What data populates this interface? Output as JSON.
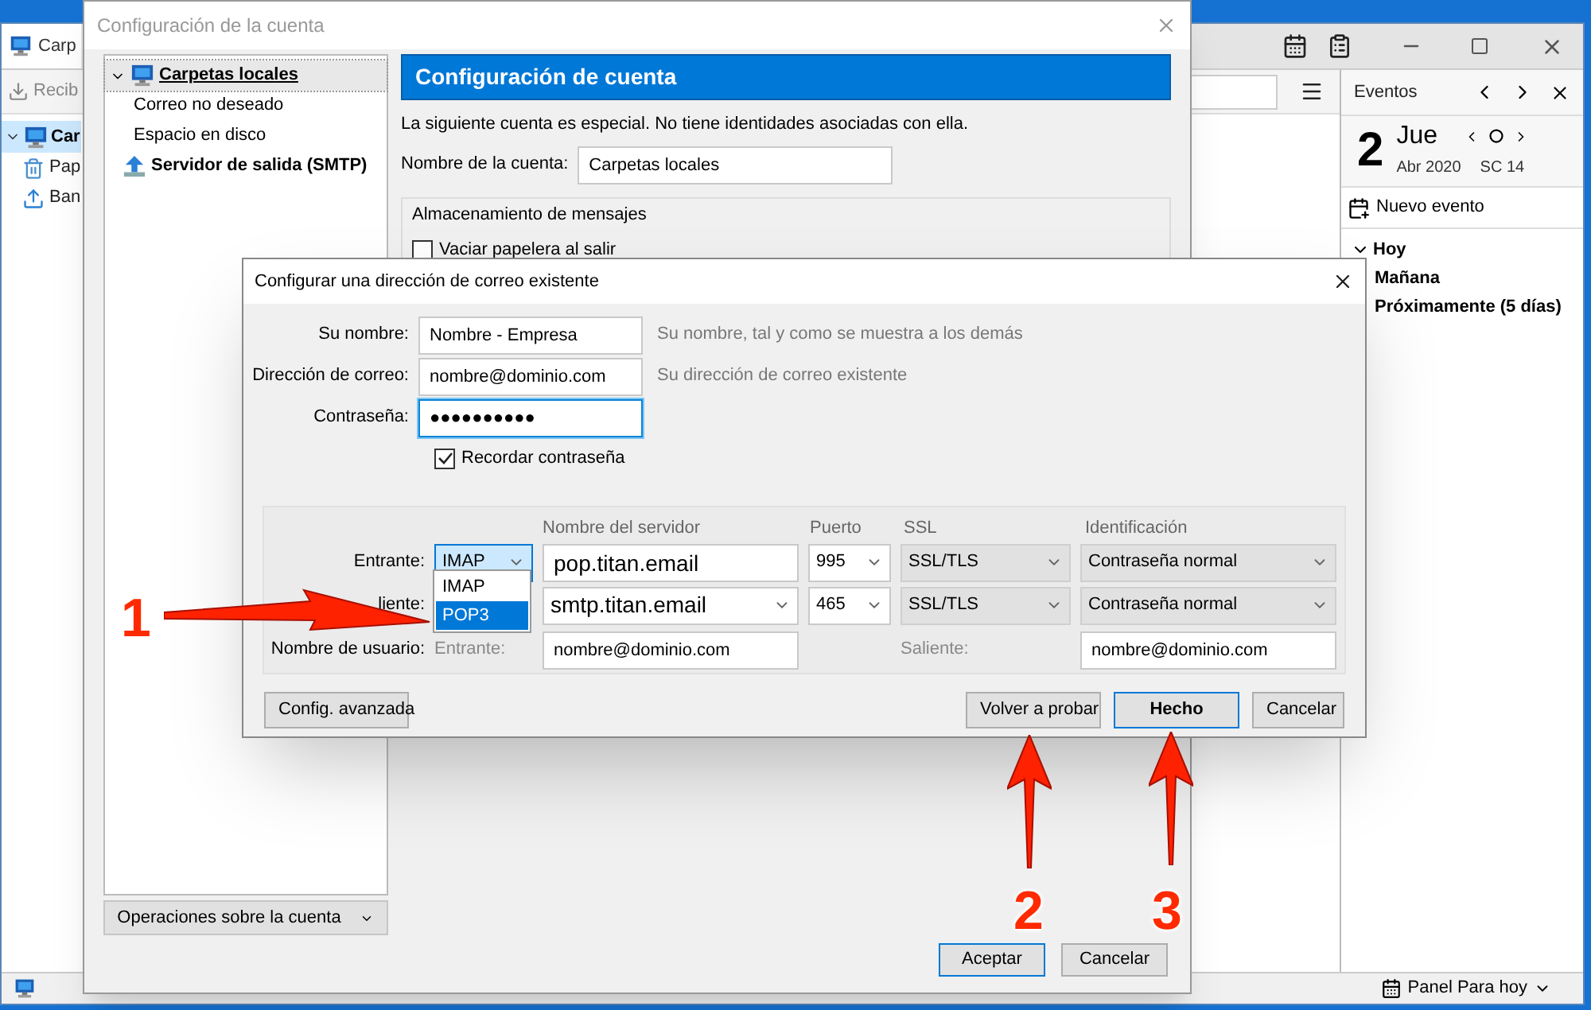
{
  "main_window": {
    "tab": {
      "label": "Carp"
    },
    "toolbar": {
      "get_mail": "Recib"
    },
    "folders": [
      {
        "label": "Car",
        "kind": "account",
        "expanded": true,
        "selected": true,
        "children": [
          {
            "label": "Pap",
            "kind": "trash",
            "selected": false
          },
          {
            "label": "Ban",
            "kind": "outbox",
            "selected": false
          }
        ]
      }
    ],
    "events_pane": {
      "title": "Eventos",
      "day": "2",
      "weekday": "Jue",
      "month_year": "Abr 2020",
      "week": "SC 14",
      "new_event": "Nuevo evento",
      "sections": [
        {
          "label": "Hoy",
          "expanded": true
        },
        {
          "label": "Mañana",
          "expanded": false
        },
        {
          "label": "Próximamente (5 días)",
          "expanded": false
        }
      ]
    },
    "status_bar": {
      "today_pane": "Panel Para hoy"
    }
  },
  "account_settings": {
    "title": "Configuración de la cuenta",
    "tree": [
      {
        "label": "Carpetas locales",
        "kind": "account",
        "expanded": true,
        "selected": true,
        "children": [
          {
            "label": "Correo no deseado",
            "selected": false
          },
          {
            "label": "Espacio en disco",
            "selected": false
          }
        ]
      },
      {
        "label": "Servidor de salida (SMTP)",
        "kind": "smtp",
        "selected": false
      }
    ],
    "account_actions": "Operaciones sobre la cuenta",
    "header": "Configuración de cuenta",
    "description": "La siguiente cuenta es especial. No tiene identidades asociadas con ella.",
    "account_name": {
      "label": "Nombre de la cuenta:",
      "value": "Carpetas locales"
    },
    "storage": {
      "title": "Almacenamiento de mensajes",
      "empty_trash": {
        "label": "Vaciar papelera al salir",
        "checked": false
      }
    },
    "buttons": [
      {
        "label": "Aceptar",
        "default": true
      },
      {
        "label": "Cancelar",
        "default": false
      }
    ]
  },
  "dialog": {
    "title": "Configurar una dirección de correo existente",
    "fields": [
      {
        "label": "Su nombre:",
        "value": "Nombre - Empresa",
        "hint": "Su nombre, tal y como se muestra a los demás",
        "focused": false
      },
      {
        "label": "Dirección de correo:",
        "value": "nombre@dominio.com",
        "hint": "Su dirección de correo existente",
        "focused": false
      },
      {
        "label": "Contraseña:",
        "value": "●●●●●●●●●●",
        "focused": true
      }
    ],
    "remember_password": {
      "label": "Recordar contraseña",
      "checked": true
    },
    "columns": [
      "Nombre del servidor",
      "Puerto",
      "SSL",
      "Identificación"
    ],
    "incoming": {
      "label": "Entrante:",
      "protocol": "IMAP",
      "server": "pop.titan.email",
      "port": "995",
      "ssl": "SSL/TLS",
      "auth": "Contraseña normal"
    },
    "outgoing": {
      "label": "liente:",
      "server": "smtp.titan.email",
      "port": "465",
      "ssl": "SSL/TLS",
      "auth": "Contraseña normal"
    },
    "username": {
      "label": "Nombre de usuario:",
      "incoming_label": "Entrante:",
      "incoming": "nombre@dominio.com",
      "outgoing_label": "Saliente:",
      "outgoing": "nombre@dominio.com"
    },
    "protocol_options": [
      {
        "label": "IMAP",
        "selected": false
      },
      {
        "label": "POP3",
        "selected": true
      }
    ],
    "buttons": [
      {
        "label": "Config. avanzada",
        "default": false
      },
      {
        "label": "Volver a probar",
        "default": false
      },
      {
        "label": "Hecho",
        "default": true
      },
      {
        "label": "Cancelar",
        "default": false
      }
    ]
  },
  "annotations": [
    {
      "label": "1"
    },
    {
      "label": "2"
    },
    {
      "label": "3"
    }
  ]
}
